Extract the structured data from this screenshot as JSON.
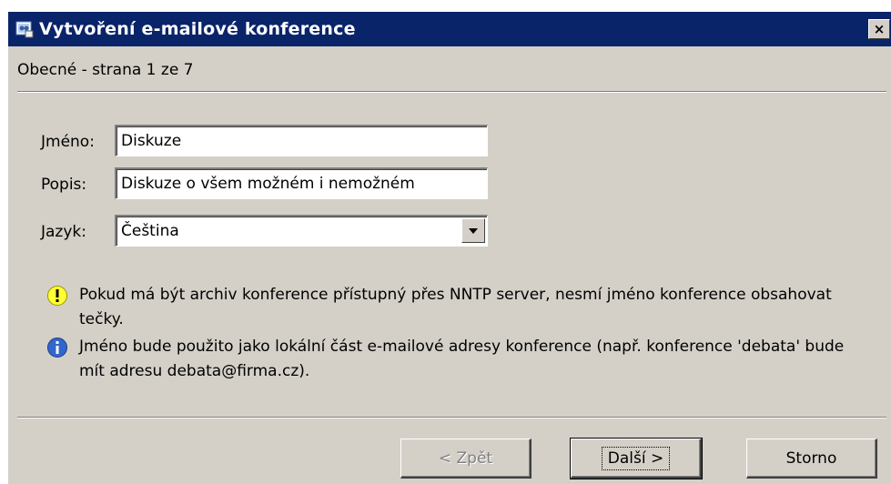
{
  "window": {
    "title": "Vytvoření e-mailové konference",
    "close_label": "×"
  },
  "header": {
    "page_label": "Obecné - strana 1 ze 7"
  },
  "form": {
    "name_label": "Jméno:",
    "name_value": "Diskuze",
    "description_label": "Popis:",
    "description_value": "Diskuze o všem možném i nemožném",
    "language_label": "Jazyk:",
    "language_value": "Čeština"
  },
  "notes": {
    "warning_text": "Pokud má být archiv konference přístupný přes NNTP server, nesmí jméno konference obsahovat tečky.",
    "info_text": "Jméno bude použito jako lokální část e-mailové adresy konference (např. konference 'debata' bude mít adresu debata@firma.cz)."
  },
  "buttons": {
    "back_label": "< Zpět",
    "next_label": "Další >",
    "cancel_label": "Storno"
  },
  "colors": {
    "titlebar": "#0a246a",
    "dialog_bg": "#d4d0c8",
    "warning_icon": "#ffff33",
    "info_icon": "#3366cc"
  }
}
